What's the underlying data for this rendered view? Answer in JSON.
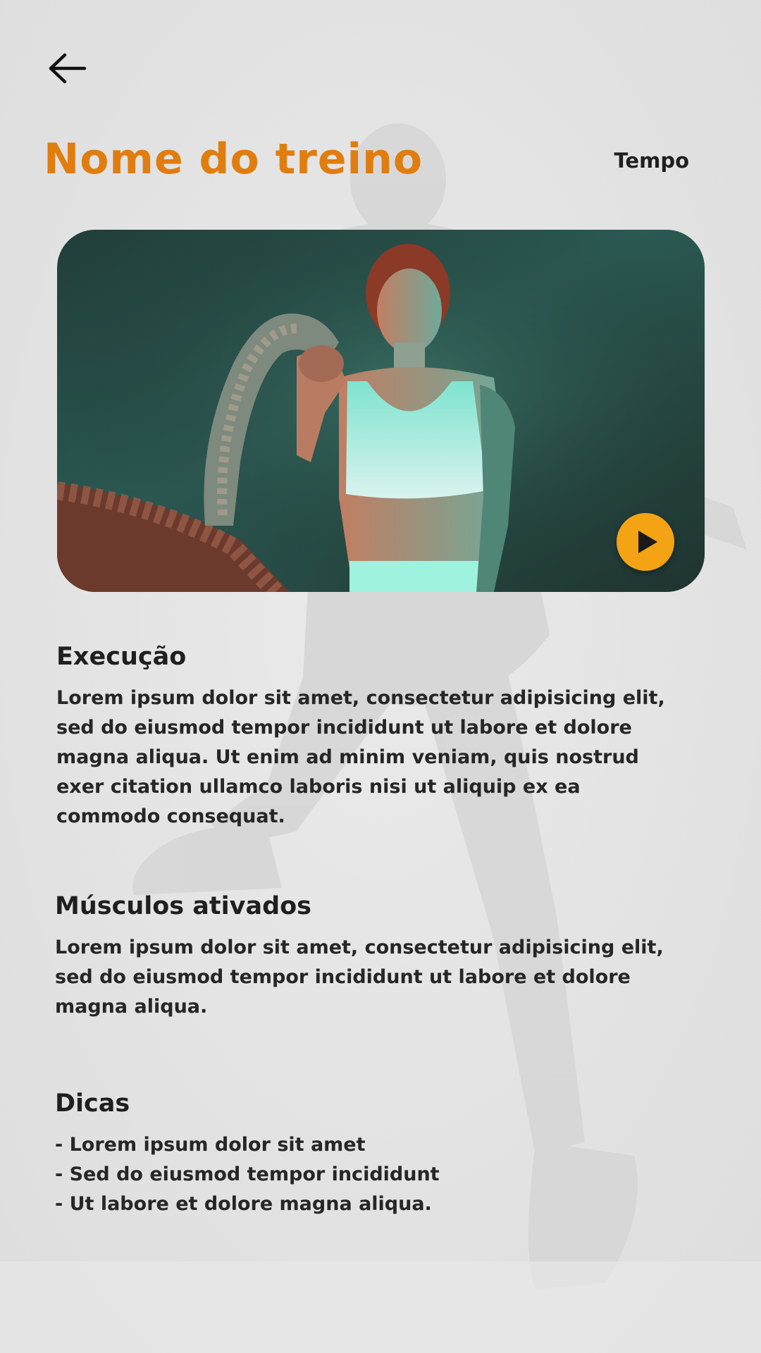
{
  "header": {
    "back_icon": "arrow-left-icon",
    "title": "Nome do treino",
    "tempo_label": "Tempo"
  },
  "video": {
    "play_icon": "play-icon",
    "play_color": "#f3a313"
  },
  "sections": {
    "execucao": {
      "title": "Execução",
      "text": "Lorem ipsum dolor sit amet, consectetur adipisicing elit, sed do eiusmod tempor incididunt ut labore et dolore magna aliqua. Ut enim ad minim veniam, quis nostrud exer citation ullamco laboris nisi ut aliquip ex ea commodo consequat."
    },
    "musculos": {
      "title": "Músculos ativados",
      "text": "Lorem ipsum dolor sit amet, consectetur adipisicing elit, sed do eiusmod tempor incididunt ut labore et dolore magna aliqua."
    },
    "dicas": {
      "title": "Dicas",
      "items": [
        "- Lorem ipsum dolor sit amet",
        "- Sed do eiusmod tempor incididunt",
        "- Ut labore et dolore magna aliqua."
      ]
    }
  },
  "colors": {
    "accent": "#e07d0e",
    "background": "#e6e6e6",
    "text": "#1f1f1f"
  }
}
